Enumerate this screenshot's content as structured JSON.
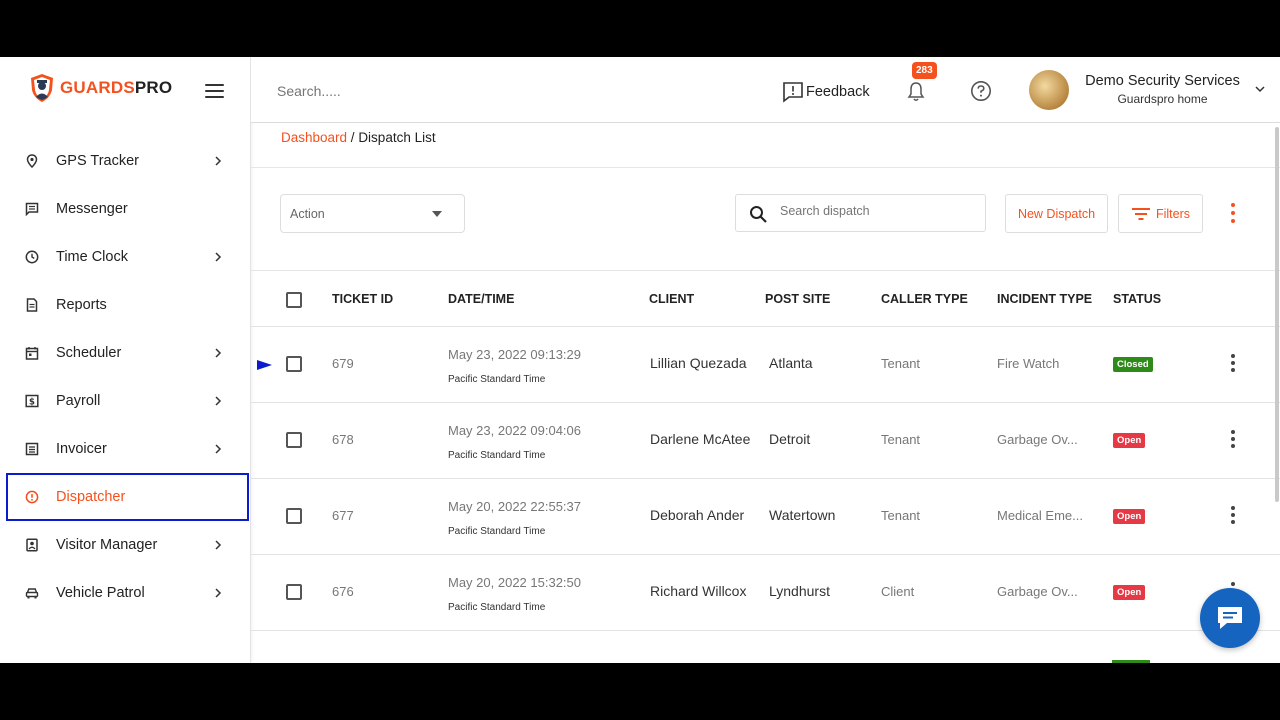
{
  "brand": {
    "name_part1": "GUARDS",
    "name_part2": "PRO"
  },
  "sidebar": {
    "items": [
      {
        "label": "GPS Tracker",
        "icon": "location-pin-icon",
        "has_chevron": true
      },
      {
        "label": "Messenger",
        "icon": "message-icon",
        "has_chevron": false
      },
      {
        "label": "Time Clock",
        "icon": "clock-icon",
        "has_chevron": true
      },
      {
        "label": "Reports",
        "icon": "document-icon",
        "has_chevron": false
      },
      {
        "label": "Scheduler",
        "icon": "calendar-icon",
        "has_chevron": true
      },
      {
        "label": "Payroll",
        "icon": "dollar-icon",
        "has_chevron": true
      },
      {
        "label": "Invoicer",
        "icon": "invoice-icon",
        "has_chevron": true
      },
      {
        "label": "Dispatcher",
        "icon": "alert-circle-icon",
        "has_chevron": false,
        "active": true
      },
      {
        "label": "Visitor Manager",
        "icon": "visitor-badge-icon",
        "has_chevron": true
      },
      {
        "label": "Vehicle Patrol",
        "icon": "car-icon",
        "has_chevron": true
      }
    ]
  },
  "header": {
    "search_placeholder": "Search.....",
    "feedback_label": "Feedback",
    "notification_count": "283",
    "company_name": "Demo Security Services",
    "company_sub": "Guardspro home"
  },
  "breadcrumb": {
    "home": "Dashboard",
    "separator": " / ",
    "current": "Dispatch List"
  },
  "toolbar": {
    "action_label": "Action",
    "search_placeholder": "Search dispatch",
    "new_dispatch_label": "New Dispatch",
    "filters_label": "Filters"
  },
  "table": {
    "headers": {
      "ticket_id": "TICKET ID",
      "datetime": "DATE/TIME",
      "client": "CLIENT",
      "post_site": "POST SITE",
      "caller_type": "CALLER TYPE",
      "incident_type": "INCIDENT TYPE",
      "status": "STATUS"
    },
    "rows": [
      {
        "ticket_id": "679",
        "datetime": "May 23, 2022 09:13:29",
        "timezone": "Pacific Standard Time",
        "client": "Lillian Quezada",
        "post_site": "Atlanta",
        "caller_type": "Tenant",
        "incident_type": "Fire Watch",
        "status": "Closed"
      },
      {
        "ticket_id": "678",
        "datetime": "May 23, 2022 09:04:06",
        "timezone": "Pacific Standard Time",
        "client": "Darlene McAtee",
        "post_site": "Detroit",
        "caller_type": "Tenant",
        "incident_type": "Garbage Ov...",
        "status": "Open"
      },
      {
        "ticket_id": "677",
        "datetime": "May 20, 2022 22:55:37",
        "timezone": "Pacific Standard Time",
        "client": "Deborah Ander",
        "post_site": "Watertown",
        "caller_type": "Tenant",
        "incident_type": "Medical Eme...",
        "status": "Open"
      },
      {
        "ticket_id": "676",
        "datetime": "May 20, 2022 15:32:50",
        "timezone": "Pacific Standard Time",
        "client": "Richard Willcox",
        "post_site": "Lyndhurst",
        "caller_type": "Client",
        "incident_type": "Garbage Ov...",
        "status": "Open"
      }
    ]
  },
  "colors": {
    "accent": "#f4511e",
    "status_closed": "#2e8b1a",
    "status_open": "#e53946",
    "highlight_outline": "#0a1ccc",
    "chat_fab": "#1565c0"
  }
}
